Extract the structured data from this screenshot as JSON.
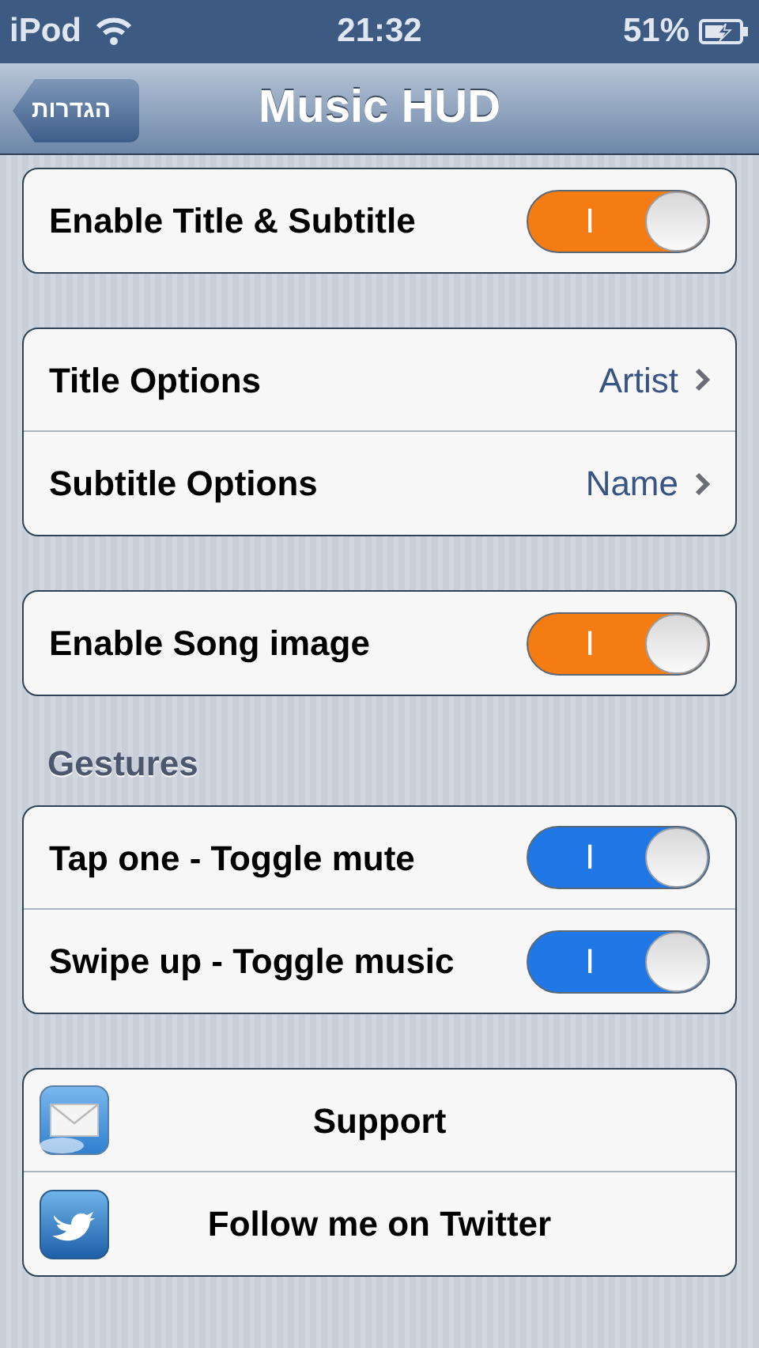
{
  "status_bar": {
    "device": "iPod",
    "time": "21:32",
    "battery": "51%"
  },
  "nav_bar": {
    "back_button": "הגדרות",
    "title": "Music HUD"
  },
  "groups": [
    {
      "rows": [
        {
          "kind": "toggle",
          "label": "Enable Title & Subtitle",
          "on": true,
          "on_label": "I",
          "color": "#f57c12"
        }
      ]
    },
    {
      "rows": [
        {
          "kind": "link",
          "label": "Title Options",
          "value": "Artist"
        },
        {
          "kind": "link",
          "label": "Subtitle Options",
          "value": "Name"
        }
      ]
    },
    {
      "rows": [
        {
          "kind": "toggle",
          "label": "Enable Song image",
          "on": true,
          "on_label": "I",
          "color": "#f57c12"
        }
      ]
    },
    {
      "header": "Gestures",
      "rows": [
        {
          "kind": "toggle",
          "label": "Tap one - Toggle mute",
          "on": true,
          "on_label": "I",
          "color": "#1f78e6"
        },
        {
          "kind": "toggle",
          "label": "Swipe up - Toggle music",
          "on": true,
          "on_label": "I",
          "color": "#1f78e6"
        }
      ]
    },
    {
      "rows": [
        {
          "kind": "action",
          "label": "Support"
        },
        {
          "kind": "action",
          "label": "Follow me on Twitter"
        }
      ]
    }
  ]
}
